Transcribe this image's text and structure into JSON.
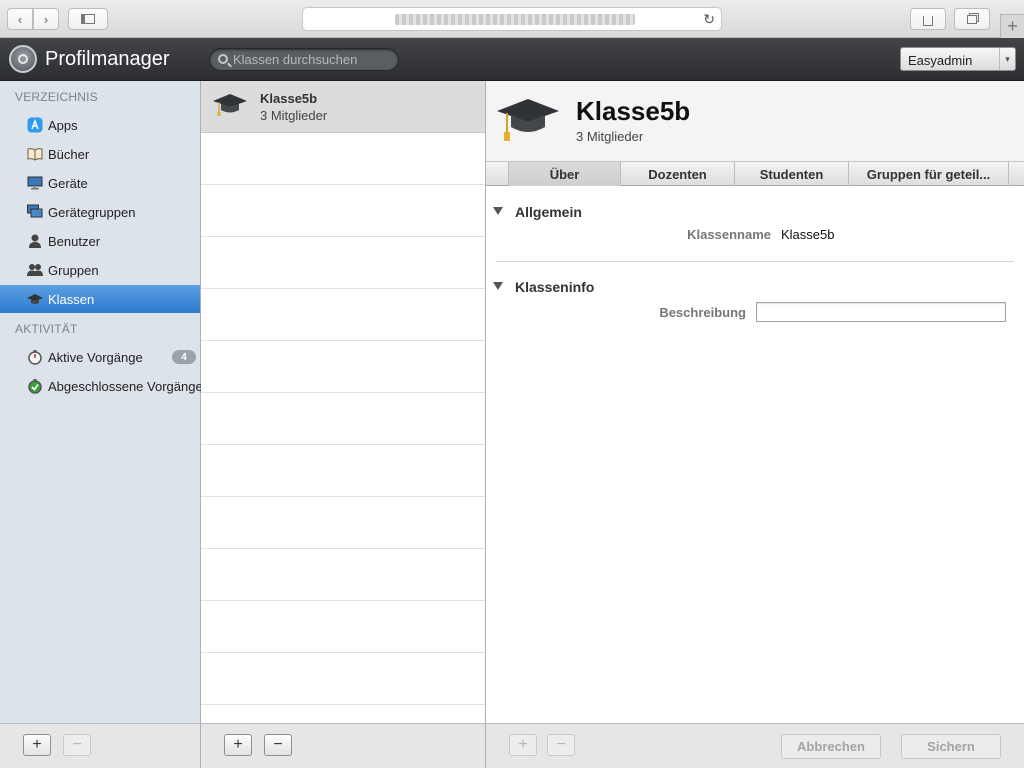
{
  "browser": {
    "url_obscured": true,
    "back_icon": "chevron-left-icon",
    "forward_icon": "chevron-right-icon",
    "sidebar_icon": "sidebar-icon",
    "reload_icon": "reload-icon",
    "share_icon": "share-icon",
    "tabs_icon": "tabs-icon",
    "new_tab_icon": "plus-icon"
  },
  "header": {
    "title": "Profilmanager",
    "search_placeholder": "Klassen durchsuchen",
    "user": "Easyadmin"
  },
  "sidebar": {
    "sections": [
      {
        "heading": "VERZEICHNIS",
        "items": [
          {
            "label": "Apps",
            "icon": "app-store-icon"
          },
          {
            "label": "Bücher",
            "icon": "book-icon"
          },
          {
            "label": "Geräte",
            "icon": "monitor-icon"
          },
          {
            "label": "Gerätegruppen",
            "icon": "device-group-icon"
          },
          {
            "label": "Benutzer",
            "icon": "user-icon"
          },
          {
            "label": "Gruppen",
            "icon": "users-icon"
          },
          {
            "label": "Klassen",
            "icon": "graduation-cap-icon",
            "selected": true
          }
        ]
      },
      {
        "heading": "AKTIVITÄT",
        "items": [
          {
            "label": "Aktive Vorgänge",
            "icon": "stopwatch-icon",
            "badge": "4"
          },
          {
            "label": "Abgeschlossene Vorgänge",
            "icon": "completed-icon"
          }
        ]
      }
    ],
    "add_label": "+",
    "remove_label": "−"
  },
  "list": {
    "items": [
      {
        "name": "Klasse5b",
        "members": "3 Mitglieder"
      }
    ],
    "add_label": "+",
    "remove_label": "−"
  },
  "detail": {
    "title": "Klasse5b",
    "subtitle": "3 Mitglieder",
    "tabs": [
      "Über",
      "Dozenten",
      "Studenten",
      "Gruppen für geteil..."
    ],
    "active_tab": "Über",
    "groups": {
      "general": {
        "title": "Allgemein",
        "field_label": "Klassenname",
        "field_value": "Klasse5b"
      },
      "info": {
        "title": "Klasseninfo",
        "field_label": "Beschreibung",
        "field_value": ""
      }
    },
    "footer": {
      "add_label": "+",
      "remove_label": "−",
      "cancel_label": "Abbrechen",
      "save_label": "Sichern"
    }
  }
}
